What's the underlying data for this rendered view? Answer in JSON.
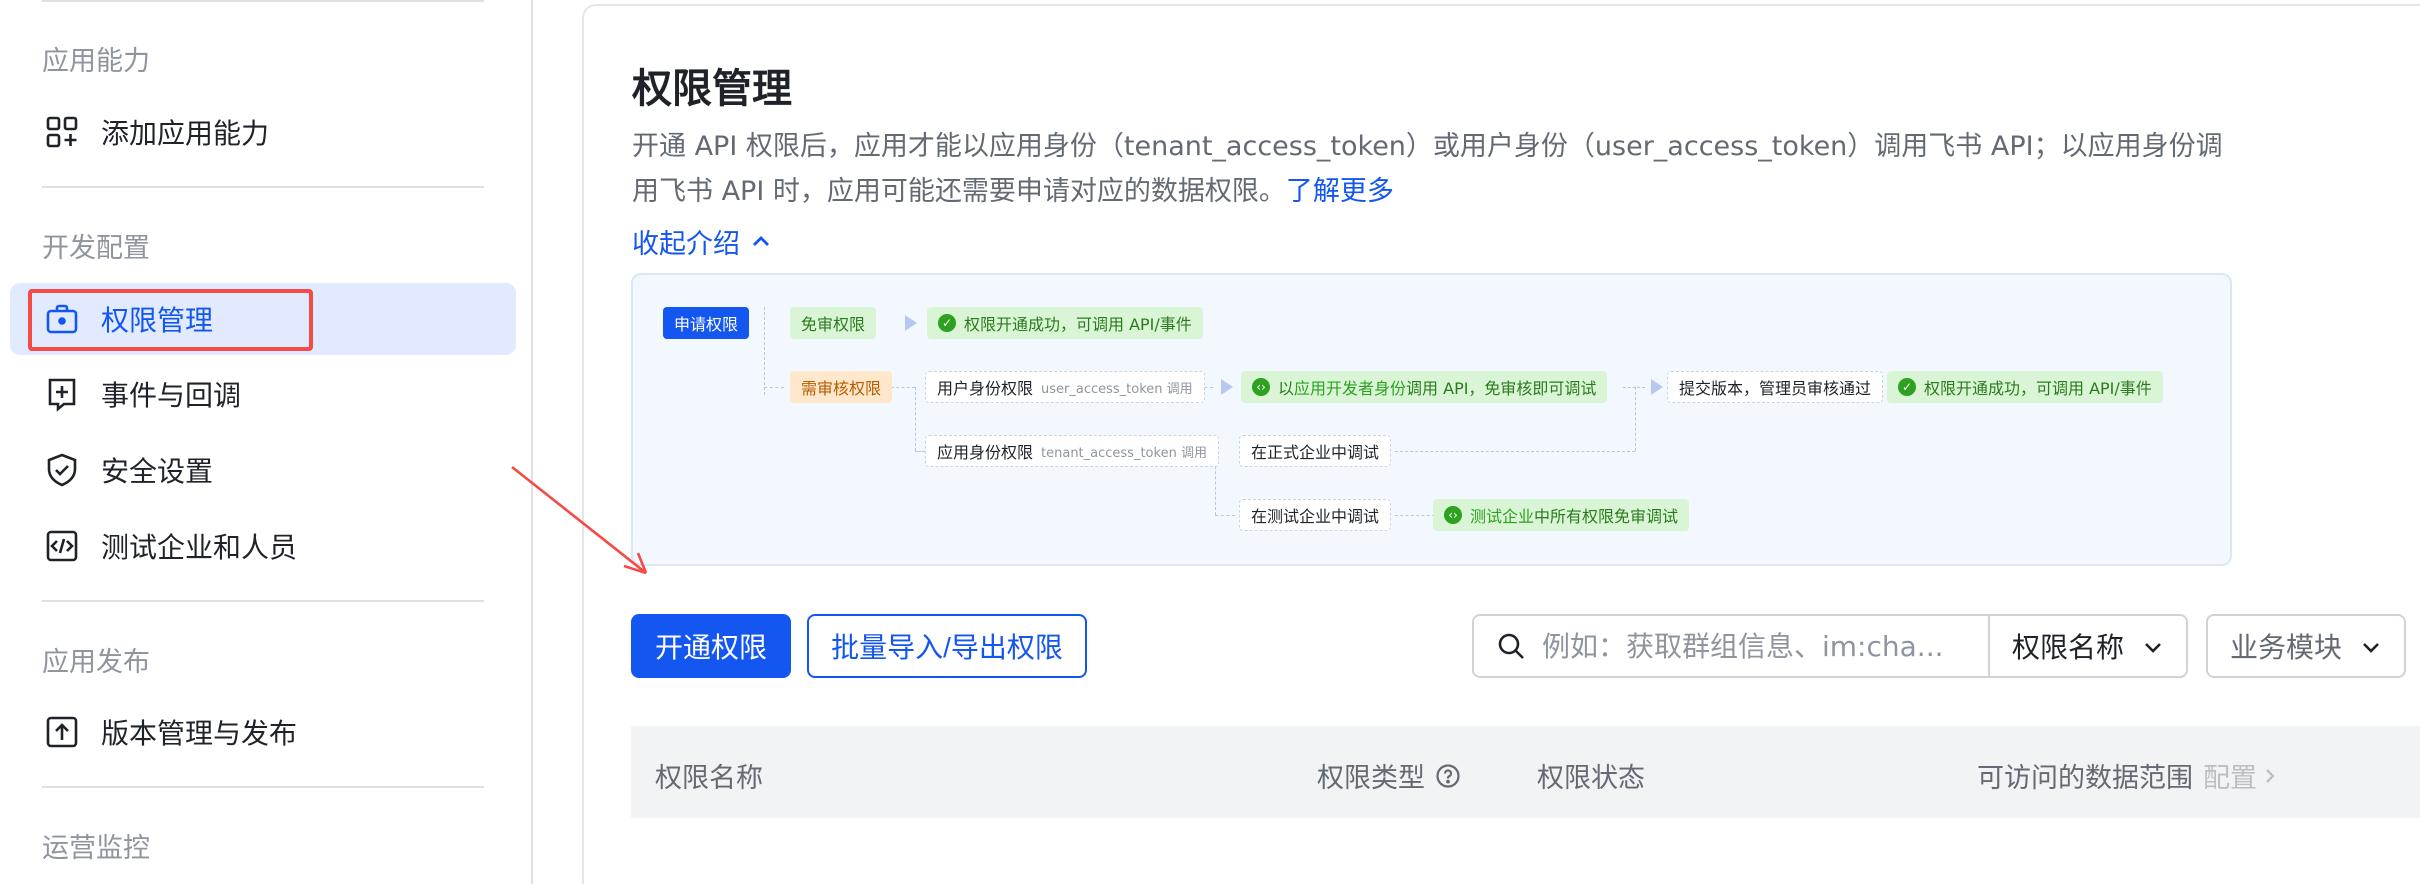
{
  "sidebar": {
    "groups": {
      "app_capability": "应用能力",
      "dev_config": "开发配置",
      "app_release": "应用发布",
      "ops_monitor": "运营监控"
    },
    "items": {
      "add_capability": "添加应用能力",
      "permission": "权限管理",
      "events": "事件与回调",
      "security": "安全设置",
      "test_enterprise": "测试企业和人员",
      "version": "版本管理与发布"
    }
  },
  "main": {
    "title": "权限管理",
    "description": "开通 API 权限后，应用才能以应用身份（tenant_access_token）或用户身份（user_access_token）调用飞书 API；以应用身份调用飞书 API 时，应用可能还需要申请对应的数据权限。",
    "learn_more": "了解更多",
    "collapse": "收起介绍",
    "flow": {
      "apply": "申请权限",
      "exempt": "免审权限",
      "success": "权限开通成功，可调用 API/事件",
      "review": "需审核权限",
      "user_perm": "用户身份权限",
      "user_perm_sub": "user_access_token 调用",
      "dev_call_prefix": "以",
      "dev_call_highlight": "应用开发者身份",
      "dev_call_suffix": "调用 API，免审核即可调试",
      "submit": "提交版本，管理员审核通过",
      "success2": "权限开通成功，可调用 API/事件",
      "app_perm": "应用身份权限",
      "app_perm_sub": "tenant_access_token 调用",
      "formal_debug": "在正式企业中调试",
      "test_debug": "在测试企业中调试",
      "test_all_highlight": "测试企业",
      "test_all_suffix": "中所有权限免审调试"
    },
    "buttons": {
      "enable": "开通权限",
      "batch": "批量导入/导出权限"
    },
    "search": {
      "placeholder": "例如：获取群组信息、im:cha..."
    },
    "filters": {
      "name": "权限名称",
      "module": "业务模块"
    },
    "table": {
      "col_name": "权限名称",
      "col_type": "权限类型",
      "col_status": "权限状态",
      "col_scope": "可访问的数据范围",
      "col_scope_config": "配置"
    }
  },
  "colors": {
    "primary": "#1456f0",
    "active_bg": "#e1eaff",
    "highlight_border": "#f54a45",
    "success": "#2ea121"
  }
}
